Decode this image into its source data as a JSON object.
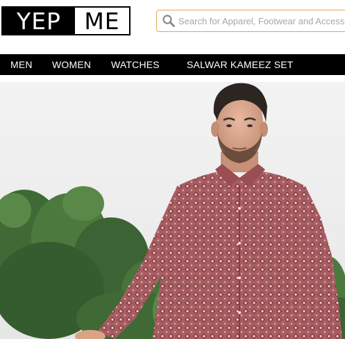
{
  "brand": {
    "logo_left": "YEP",
    "logo_right": "ME"
  },
  "search": {
    "placeholder": "Search for Apparel, Footwear and Accessories"
  },
  "nav": {
    "items": [
      {
        "label": "MEN"
      },
      {
        "label": "WOMEN"
      },
      {
        "label": "WATCHES"
      },
      {
        "label": "SALWAR KAMEEZ SET"
      }
    ]
  },
  "hero": {
    "image": "banner-man-in-printed-shirt"
  },
  "colors": {
    "nav_background": "#000000",
    "search_border": "#e0a45c",
    "shirt": "#a85d62"
  },
  "icons": {
    "search": "search-icon"
  }
}
